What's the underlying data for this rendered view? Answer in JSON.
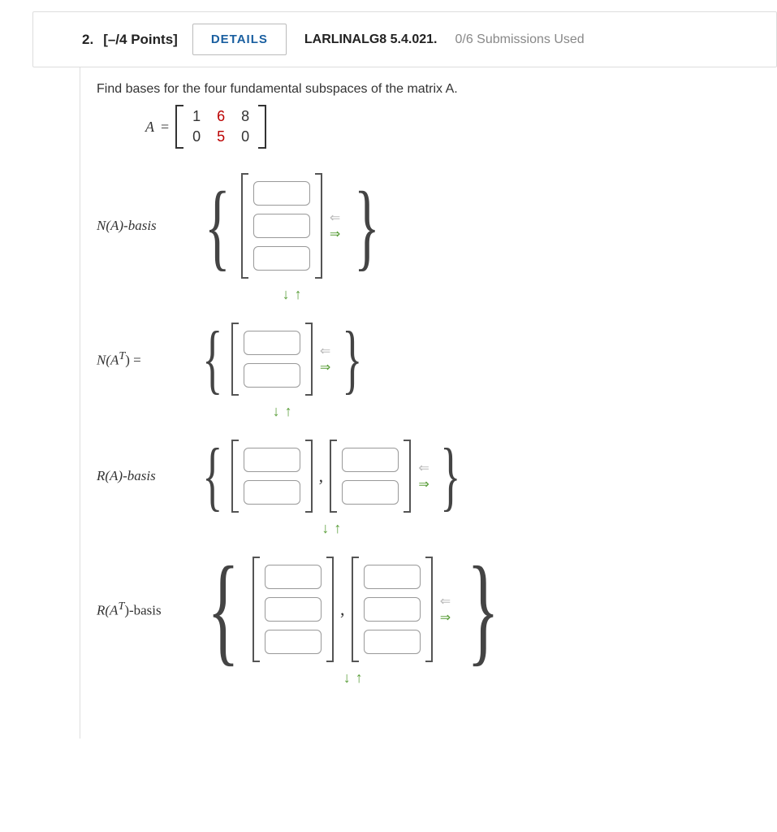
{
  "header": {
    "qnum": "2.",
    "points": "[–/4 Points]",
    "details_label": "DETAILS",
    "reference": "LARLINALG8 5.4.021.",
    "submissions": "0/6 Submissions Used"
  },
  "prompt": "Find bases for the four fundamental subspaces of the matrix A.",
  "matrix": {
    "label": "A",
    "eq": "=",
    "rows": [
      [
        "1",
        "6",
        "8"
      ],
      [
        "0",
        "5",
        "0"
      ]
    ],
    "highlight": {
      "0,1": true,
      "1,1": true
    }
  },
  "sections": [
    {
      "label_html": "N(A)-basis",
      "vectors": [
        {
          "rows": 3
        }
      ],
      "brace": "sm"
    },
    {
      "label_html": "N(A^T) =",
      "vectors": [
        {
          "rows": 2
        }
      ],
      "brace": "sm"
    },
    {
      "label_html": "R(A)-basis",
      "vectors": [
        {
          "rows": 2
        },
        {
          "rows": 2
        }
      ],
      "brace": "sm"
    },
    {
      "label_html": "R(A^T)-basis",
      "vectors": [
        {
          "rows": 3
        },
        {
          "rows": 3
        }
      ],
      "brace": "lg"
    }
  ],
  "labels": {
    "na": "N(A)-basis",
    "nat_pre": "N(A",
    "nat_sup": "T",
    "nat_post": ") =",
    "ra": "R(A)-basis",
    "rat_pre": "R(A",
    "rat_sup": "T",
    "rat_post": ")-basis"
  }
}
